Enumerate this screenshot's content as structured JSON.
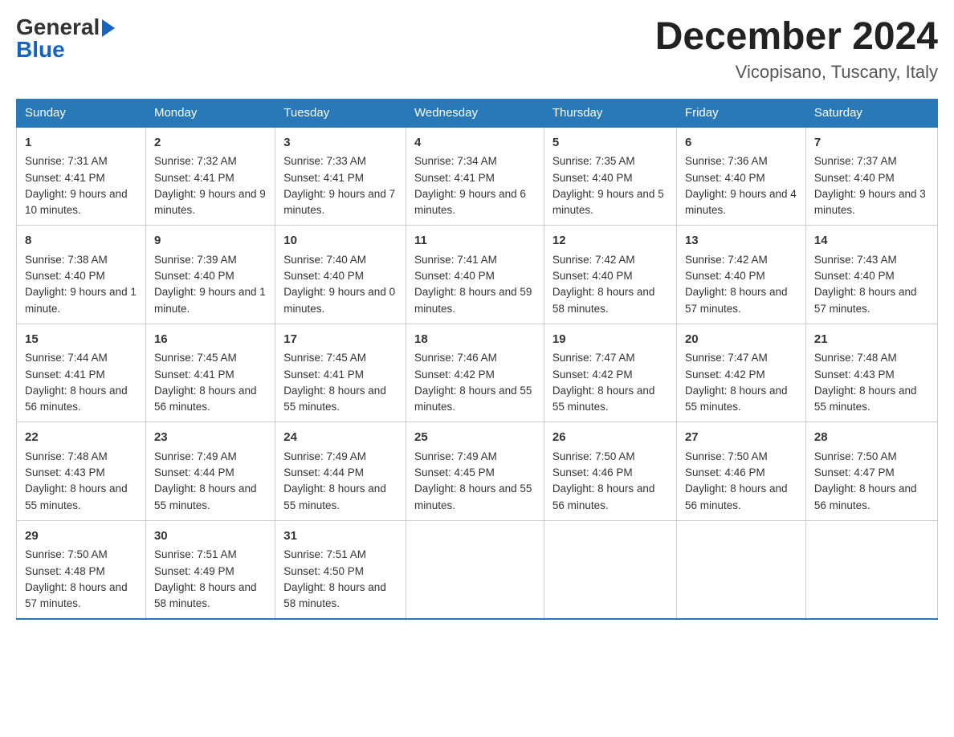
{
  "logo": {
    "line1": "General",
    "arrow": "▶",
    "line2": "Blue"
  },
  "title": "December 2024",
  "subtitle": "Vicopisano, Tuscany, Italy",
  "days": [
    "Sunday",
    "Monday",
    "Tuesday",
    "Wednesday",
    "Thursday",
    "Friday",
    "Saturday"
  ],
  "weeks": [
    [
      {
        "num": "1",
        "sunrise": "7:31 AM",
        "sunset": "4:41 PM",
        "daylight": "9 hours and 10 minutes."
      },
      {
        "num": "2",
        "sunrise": "7:32 AM",
        "sunset": "4:41 PM",
        "daylight": "9 hours and 9 minutes."
      },
      {
        "num": "3",
        "sunrise": "7:33 AM",
        "sunset": "4:41 PM",
        "daylight": "9 hours and 7 minutes."
      },
      {
        "num": "4",
        "sunrise": "7:34 AM",
        "sunset": "4:41 PM",
        "daylight": "9 hours and 6 minutes."
      },
      {
        "num": "5",
        "sunrise": "7:35 AM",
        "sunset": "4:40 PM",
        "daylight": "9 hours and 5 minutes."
      },
      {
        "num": "6",
        "sunrise": "7:36 AM",
        "sunset": "4:40 PM",
        "daylight": "9 hours and 4 minutes."
      },
      {
        "num": "7",
        "sunrise": "7:37 AM",
        "sunset": "4:40 PM",
        "daylight": "9 hours and 3 minutes."
      }
    ],
    [
      {
        "num": "8",
        "sunrise": "7:38 AM",
        "sunset": "4:40 PM",
        "daylight": "9 hours and 1 minute."
      },
      {
        "num": "9",
        "sunrise": "7:39 AM",
        "sunset": "4:40 PM",
        "daylight": "9 hours and 1 minute."
      },
      {
        "num": "10",
        "sunrise": "7:40 AM",
        "sunset": "4:40 PM",
        "daylight": "9 hours and 0 minutes."
      },
      {
        "num": "11",
        "sunrise": "7:41 AM",
        "sunset": "4:40 PM",
        "daylight": "8 hours and 59 minutes."
      },
      {
        "num": "12",
        "sunrise": "7:42 AM",
        "sunset": "4:40 PM",
        "daylight": "8 hours and 58 minutes."
      },
      {
        "num": "13",
        "sunrise": "7:42 AM",
        "sunset": "4:40 PM",
        "daylight": "8 hours and 57 minutes."
      },
      {
        "num": "14",
        "sunrise": "7:43 AM",
        "sunset": "4:40 PM",
        "daylight": "8 hours and 57 minutes."
      }
    ],
    [
      {
        "num": "15",
        "sunrise": "7:44 AM",
        "sunset": "4:41 PM",
        "daylight": "8 hours and 56 minutes."
      },
      {
        "num": "16",
        "sunrise": "7:45 AM",
        "sunset": "4:41 PM",
        "daylight": "8 hours and 56 minutes."
      },
      {
        "num": "17",
        "sunrise": "7:45 AM",
        "sunset": "4:41 PM",
        "daylight": "8 hours and 55 minutes."
      },
      {
        "num": "18",
        "sunrise": "7:46 AM",
        "sunset": "4:42 PM",
        "daylight": "8 hours and 55 minutes."
      },
      {
        "num": "19",
        "sunrise": "7:47 AM",
        "sunset": "4:42 PM",
        "daylight": "8 hours and 55 minutes."
      },
      {
        "num": "20",
        "sunrise": "7:47 AM",
        "sunset": "4:42 PM",
        "daylight": "8 hours and 55 minutes."
      },
      {
        "num": "21",
        "sunrise": "7:48 AM",
        "sunset": "4:43 PM",
        "daylight": "8 hours and 55 minutes."
      }
    ],
    [
      {
        "num": "22",
        "sunrise": "7:48 AM",
        "sunset": "4:43 PM",
        "daylight": "8 hours and 55 minutes."
      },
      {
        "num": "23",
        "sunrise": "7:49 AM",
        "sunset": "4:44 PM",
        "daylight": "8 hours and 55 minutes."
      },
      {
        "num": "24",
        "sunrise": "7:49 AM",
        "sunset": "4:44 PM",
        "daylight": "8 hours and 55 minutes."
      },
      {
        "num": "25",
        "sunrise": "7:49 AM",
        "sunset": "4:45 PM",
        "daylight": "8 hours and 55 minutes."
      },
      {
        "num": "26",
        "sunrise": "7:50 AM",
        "sunset": "4:46 PM",
        "daylight": "8 hours and 56 minutes."
      },
      {
        "num": "27",
        "sunrise": "7:50 AM",
        "sunset": "4:46 PM",
        "daylight": "8 hours and 56 minutes."
      },
      {
        "num": "28",
        "sunrise": "7:50 AM",
        "sunset": "4:47 PM",
        "daylight": "8 hours and 56 minutes."
      }
    ],
    [
      {
        "num": "29",
        "sunrise": "7:50 AM",
        "sunset": "4:48 PM",
        "daylight": "8 hours and 57 minutes."
      },
      {
        "num": "30",
        "sunrise": "7:51 AM",
        "sunset": "4:49 PM",
        "daylight": "8 hours and 58 minutes."
      },
      {
        "num": "31",
        "sunrise": "7:51 AM",
        "sunset": "4:50 PM",
        "daylight": "8 hours and 58 minutes."
      },
      null,
      null,
      null,
      null
    ]
  ],
  "labels": {
    "sunrise": "Sunrise:",
    "sunset": "Sunset:",
    "daylight": "Daylight:"
  }
}
